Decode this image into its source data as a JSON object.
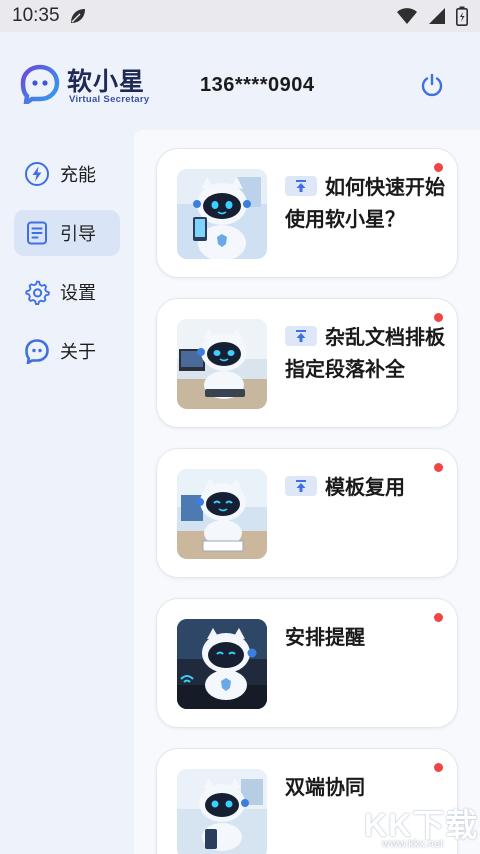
{
  "status_bar": {
    "time": "10:35"
  },
  "header": {
    "brand_title": "软小星",
    "brand_subtitle": "Virtual Secretary",
    "phone": "136****0904"
  },
  "sidebar": {
    "items": [
      {
        "label": "充能",
        "icon": "lightning-icon",
        "active": false
      },
      {
        "label": "引导",
        "icon": "document-icon",
        "active": true
      },
      {
        "label": "设置",
        "icon": "gear-icon",
        "active": false
      },
      {
        "label": "关于",
        "icon": "chat-logo-icon",
        "active": false
      }
    ]
  },
  "cards": [
    {
      "title": "如何快速开始使用软小星？",
      "pinned": true,
      "unread": true
    },
    {
      "title": "杂乱文档排板指定段落补全",
      "pinned": true,
      "unread": true
    },
    {
      "title": "模板复用",
      "pinned": true,
      "unread": true
    },
    {
      "title": "安排提醒",
      "pinned": false,
      "unread": true
    },
    {
      "title": "双端协同",
      "pinned": false,
      "unread": true
    }
  ],
  "watermark": {
    "text": "KK下载",
    "url": "www.kkx.net"
  },
  "colors": {
    "accent": "#3f6fe0",
    "unread_dot": "#f04545",
    "active_nav_bg": "#d9e5f6"
  }
}
